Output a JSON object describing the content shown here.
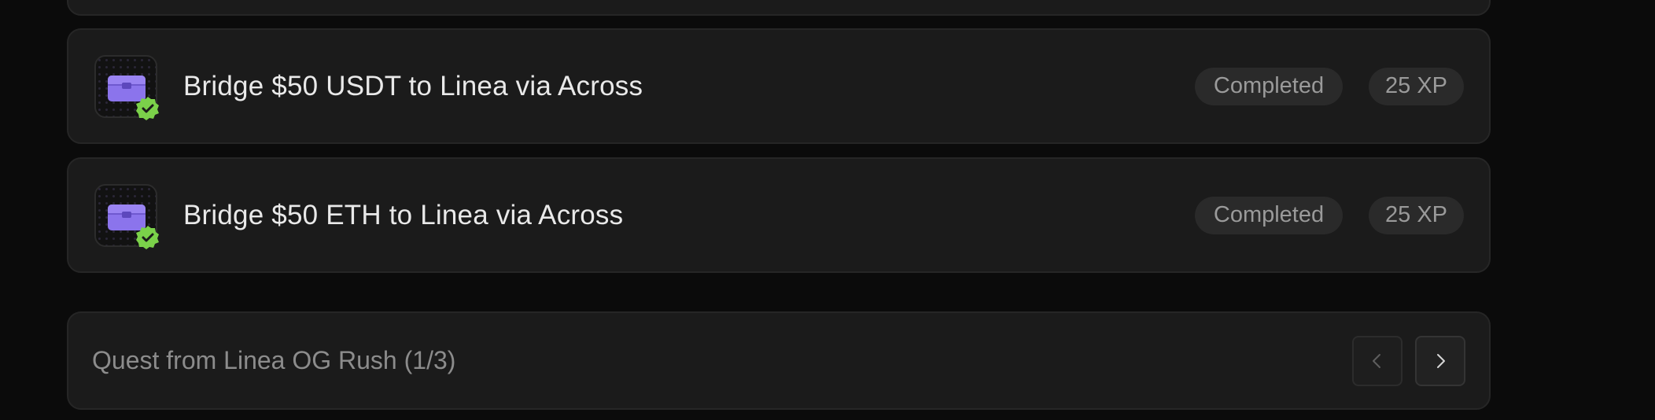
{
  "quests": [
    {
      "title": "Bridge $50 USDT to Linea via Across",
      "status": "Completed",
      "xp": "25 XP",
      "icon": "chest-icon"
    },
    {
      "title": "Bridge $50 ETH to Linea via Across",
      "status": "Completed",
      "xp": "25 XP",
      "icon": "chest-icon"
    }
  ],
  "footer": {
    "text": "Quest from Linea OG Rush (1/3)"
  },
  "colors": {
    "chest": "#8b74ec",
    "check_badge": "#7bd14a",
    "card_bg": "#1b1b1b",
    "pill_bg": "#2a2a2a"
  }
}
